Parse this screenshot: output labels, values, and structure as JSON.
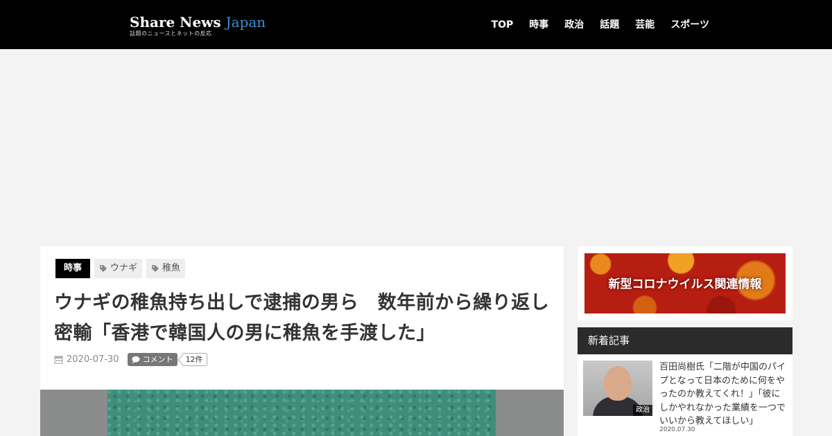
{
  "site": {
    "logo_main": "Share News",
    "logo_accent": "Japan",
    "logo_sub": "話題のニュースとネットの反応"
  },
  "nav": [
    "TOP",
    "時事",
    "政治",
    "話題",
    "芸能",
    "スポーツ"
  ],
  "article": {
    "category": "時事",
    "tags": [
      "ウナギ",
      "稚魚"
    ],
    "title": "ウナギの稚魚持ち出しで逮捕の男ら　数年前から繰り返し密輸「香港で韓国人の男に稚魚を手渡した」",
    "date": "2020-07-30",
    "comment_label": "コメント",
    "comment_count": "12件"
  },
  "sidebar": {
    "banner_text": "新型コロナウイルス関連情報",
    "new_heading": "新着記事",
    "items": [
      {
        "title": "百田尚樹氏「二階が中国のパイプとなって日本のために何をやったのか教えてくれ！」「彼にしかやれなかった業績を一つでいいから教えてほしい」",
        "category": "政治",
        "date": "2020.07.30"
      }
    ]
  },
  "colors": {
    "header_bg": "#000000",
    "logo_accent": "#3d8fd6",
    "category_bg": "#000000",
    "sidebar_head_bg": "#2b2b2b"
  }
}
